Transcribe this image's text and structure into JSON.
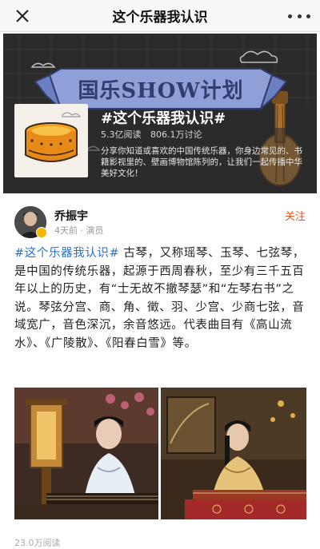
{
  "navbar": {
    "title": "这个乐器我认识",
    "close_icon": "close-icon",
    "more_icon": "more-icon"
  },
  "banner": {
    "title": "国乐SHOW计划",
    "topic_name": "#这个乐器我认识#",
    "stats": {
      "reads": "5.3亿阅读",
      "discussions": "806.1万讨论"
    },
    "description": "分享你知道或喜欢的中国传统乐器，你身边常见的、书籍影视里的、壁画博物馆陈列的，让我们一起传播中华美好文化！"
  },
  "post": {
    "author": "乔振宇",
    "meta": "4天前 · 演员",
    "follow_label": "关注",
    "hashtag": "#这个乐器我认识#",
    "text": " 古琴，又称瑶琴、玉琴、七弦琴，是中国的传统乐器，起源于西周春秋，至少有三千五百年以上的历史，有“士无故不撤琴瑟”和“左琴右书”之说。琴弦分宫、商、角、徵、羽、少宫、少商七弦，音域宽广，音色深沉，余音悠远。代表曲目有《高山流水》、《广陵散》、《阳春白雪》等。",
    "read_count": "23.0万阅读"
  },
  "colors": {
    "accent": "#e8531f",
    "link": "#2a6fc9",
    "banner_bg": "#2c2b2c",
    "ribbon": "#8fa0d8"
  }
}
